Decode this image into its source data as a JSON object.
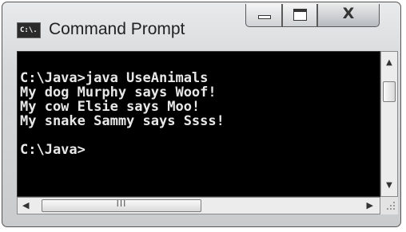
{
  "window": {
    "title": "Command Prompt",
    "icon_label": "C:\\."
  },
  "controls": {
    "minimize_icon": "minimize-icon",
    "maximize_icon": "maximize-icon",
    "close_glyph": "X"
  },
  "console": {
    "lines": [
      "C:\\Java>java UseAnimals",
      "My dog Murphy says Woof!",
      "My cow Elsie says Moo!",
      "My snake Sammy says Ssss!",
      "",
      "C:\\Java>"
    ]
  },
  "scrollbars": {
    "up_glyph": "▲",
    "down_glyph": "▼",
    "left_glyph": "◀",
    "right_glyph": "▶",
    "grip_glyph": "III"
  },
  "colors": {
    "console_bg": "#000000",
    "console_text": "#e8e8e8"
  }
}
